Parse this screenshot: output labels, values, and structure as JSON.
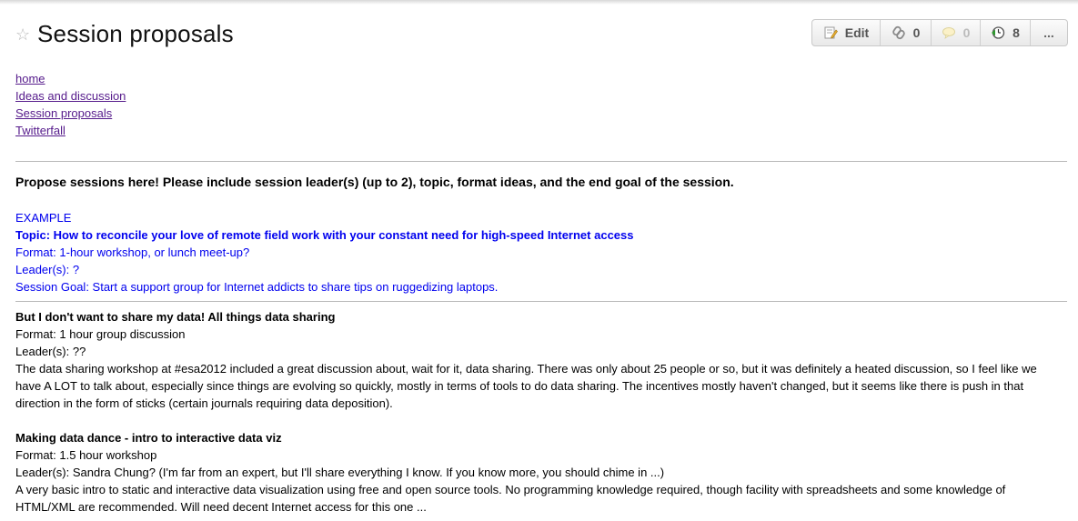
{
  "page": {
    "title": "Session proposals"
  },
  "toolbar": {
    "edit_label": "Edit",
    "links_count": "0",
    "comments_count": "0",
    "history_count": "8",
    "more_label": "..."
  },
  "nav": {
    "items": [
      "home",
      "Ideas and discussion",
      "Session proposals",
      "Twitterfall"
    ]
  },
  "intro": "Propose sessions here! Please include session leader(s) (up to 2), topic, format ideas, and the end goal of the session.",
  "example": {
    "heading": "EXAMPLE",
    "topic": "Topic: How to reconcile your love of remote field work with your constant need for high-speed Internet access",
    "format": "Format: 1-hour workshop, or lunch meet-up?",
    "leaders": "Leader(s): ?",
    "goal": "Session Goal: Start a support group for Internet addicts to share tips on ruggedizing laptops."
  },
  "proposals": [
    {
      "title": "But I don't want to share my data! All things data sharing",
      "format": "Format: 1 hour group discussion",
      "leaders": "Leader(s): ??",
      "description": "The data sharing workshop at #esa2012 included a great discussion about, wait for it, data sharing. There was only about 25 people or so, but it was definitely a heated discussion, so I feel like we have A LOT to talk about, especially since things are evolving so quickly, mostly in terms of tools to do data sharing. The incentives mostly haven't changed, but it seems like there is push in that direction in the form of sticks (certain journals requiring data deposition)."
    },
    {
      "title": "Making data dance - intro to interactive data viz",
      "format": "Format: 1.5 hour workshop",
      "leaders": "Leader(s): Sandra Chung? (I'm far from an expert, but I'll share everything I know. If you know more, you should chime in ...)",
      "description": "A very basic intro to static and interactive data visualization using free and open source tools. No programming knowledge required, though facility with spreadsheets and some knowledge of HTML/XML are recommended. Will need decent Internet access for this one ..."
    }
  ]
}
